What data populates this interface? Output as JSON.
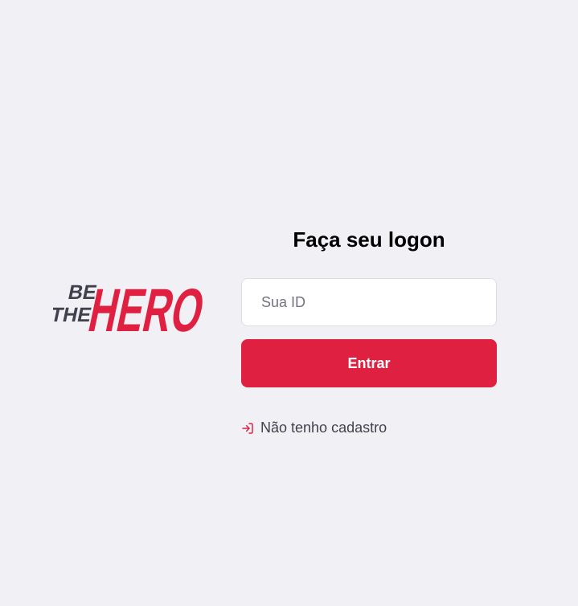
{
  "logo": {
    "line1": "BE",
    "line2": "THE",
    "line3": "HERO",
    "colors": {
      "dark": "#41414d",
      "brand": "#e02041"
    }
  },
  "login": {
    "title": "Faça seu logon",
    "id_input": {
      "placeholder": "Sua ID",
      "value": ""
    },
    "submit_label": "Entrar",
    "register_link": {
      "label": "Não tenho cadastro",
      "icon": "log-in-icon"
    }
  },
  "colors": {
    "background": "#f0f0f5",
    "brand": "#e02041",
    "text": "#41414d"
  }
}
